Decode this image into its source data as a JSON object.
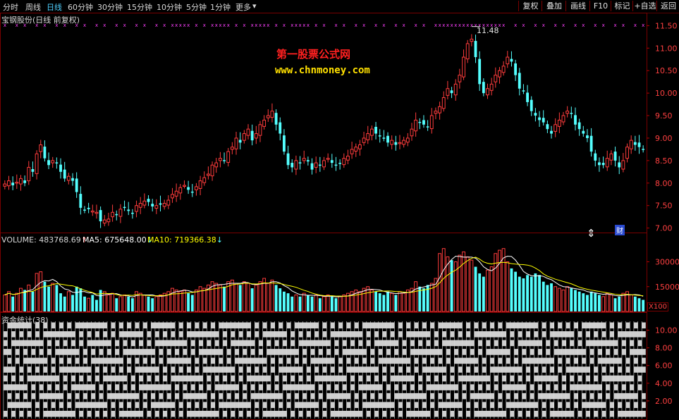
{
  "toolbar": {
    "timeframes": [
      {
        "label": "分时",
        "active": false
      },
      {
        "label": "周线",
        "active": false
      },
      {
        "label": "日线",
        "active": true
      },
      {
        "label": "60分钟",
        "active": false
      },
      {
        "label": "30分钟",
        "active": false
      },
      {
        "label": "15分钟",
        "active": false
      },
      {
        "label": "10分钟",
        "active": false
      },
      {
        "label": "5分钟",
        "active": false
      },
      {
        "label": "1分钟",
        "active": false
      },
      {
        "label": "更多",
        "active": false
      }
    ],
    "more_arrow": "▾",
    "right_buttons": [
      "复权",
      "叠加",
      "画线",
      "F10",
      "标记",
      "+自选",
      "返回"
    ]
  },
  "price_panel": {
    "title": "宝钢股份(日线 前复权)",
    "max_label": "11.48",
    "axis_ticks": [
      "11.50",
      "11.00",
      "10.50",
      "10.00",
      "9.50",
      "9.00",
      "8.50",
      "8.00",
      "7.50",
      "7.00"
    ],
    "watermark_title": "第一股票公式网",
    "watermark_url": "www.chnmoney.com",
    "finance_badge": "财",
    "resize_icon": "⇕"
  },
  "volume_panel": {
    "label_volume": "VOLUME: 483768.69",
    "label_ma5": "MA5: 675648.00",
    "label_ma10": "MA10: 719366.38",
    "volume_arrow": "↑",
    "ma5_arrow": "↓",
    "ma10_arrow": "↓",
    "axis_ticks": [
      "30000",
      "15000"
    ],
    "unit": "X100"
  },
  "fund_panel": {
    "title": "资金统计(38)",
    "axis_ticks": [
      "10.00",
      "8.00",
      "6.00",
      "4.00",
      "2.00"
    ]
  },
  "colors": {
    "up": "#ff3c3c",
    "down": "#54ffff",
    "ma5": "#ffffff",
    "ma10": "#ffff00",
    "grid": "#7a0000",
    "marker": "#ff40ff",
    "watermark_title": "#ff2020",
    "watermark_url": "#ffe000"
  },
  "chart_data": {
    "type": "candlestick",
    "ylim": [
      6.9,
      11.6
    ],
    "close": [
      7.98,
      8.05,
      7.95,
      8.02,
      8.1,
      8.0,
      8.35,
      8.25,
      8.65,
      8.85,
      8.55,
      8.4,
      8.5,
      8.45,
      8.25,
      8.1,
      8.15,
      8.05,
      7.8,
      7.45,
      7.4,
      7.42,
      7.38,
      7.35,
      7.15,
      7.18,
      7.2,
      7.35,
      7.3,
      7.42,
      7.45,
      7.38,
      7.32,
      7.5,
      7.55,
      7.6,
      7.58,
      7.48,
      7.5,
      7.52,
      7.55,
      7.62,
      7.75,
      7.82,
      7.9,
      7.95,
      7.85,
      7.8,
      7.92,
      8.05,
      8.12,
      8.2,
      8.4,
      8.45,
      8.55,
      8.5,
      8.7,
      8.8,
      9.0,
      8.9,
      9.1,
      9.2,
      8.95,
      9.1,
      9.3,
      9.4,
      9.5,
      9.6,
      9.3,
      9.1,
      8.7,
      8.4,
      8.35,
      8.5,
      8.45,
      8.55,
      8.48,
      8.3,
      8.45,
      8.4,
      8.5,
      8.55,
      8.45,
      8.4,
      8.45,
      8.55,
      8.6,
      8.75,
      8.8,
      8.85,
      9.0,
      9.1,
      9.2,
      9.1,
      9.05,
      9.0,
      8.9,
      8.95,
      8.85,
      8.9,
      8.95,
      9.0,
      9.2,
      9.4,
      9.35,
      9.3,
      9.25,
      9.5,
      9.6,
      9.7,
      9.9,
      10.1,
      10.0,
      10.2,
      10.4,
      10.8,
      11.1,
      11.2,
      10.8,
      10.2,
      10.0,
      10.1,
      10.2,
      10.4,
      10.5,
      10.6,
      10.8,
      10.7,
      10.4,
      10.1,
      10.05,
      9.8,
      9.6,
      9.5,
      9.4,
      9.35,
      9.2,
      9.1,
      9.3,
      9.4,
      9.5,
      9.6,
      9.55,
      9.3,
      9.2,
      9.1,
      9.0,
      8.7,
      8.5,
      8.4,
      8.4,
      8.55,
      8.65,
      8.5,
      8.35,
      8.5,
      8.8,
      8.95,
      8.85,
      8.8,
      8.75
    ],
    "volume": [
      10000,
      12000,
      9000,
      11000,
      14000,
      13000,
      16000,
      12000,
      23000,
      24000,
      18000,
      15000,
      17000,
      16000,
      11000,
      9000,
      12000,
      10000,
      15000,
      14000,
      9000,
      8000,
      10000,
      7000,
      13000,
      12000,
      10000,
      11000,
      8000,
      9000,
      10000,
      9000,
      8000,
      12000,
      11000,
      10000,
      9000,
      8000,
      9000,
      10000,
      11000,
      12000,
      14000,
      13000,
      12000,
      13000,
      11000,
      10000,
      13000,
      15000,
      14000,
      16000,
      18000,
      17000,
      16000,
      15000,
      18000,
      19000,
      17000,
      16000,
      18000,
      17000,
      14000,
      16000,
      18000,
      20000,
      17000,
      19000,
      16000,
      14000,
      12000,
      11000,
      9000,
      10000,
      9000,
      11000,
      10000,
      9000,
      10000,
      8000,
      9000,
      10000,
      9000,
      8000,
      9000,
      10000,
      11000,
      12000,
      13000,
      12000,
      14000,
      15000,
      13000,
      12000,
      11000,
      10000,
      12000,
      11000,
      10000,
      12000,
      11000,
      13000,
      14000,
      18000,
      15000,
      14000,
      16000,
      17000,
      20000,
      35000,
      38000,
      33000,
      31000,
      30000,
      34000,
      36000,
      33000,
      31000,
      27000,
      23000,
      21000,
      25000,
      27000,
      35000,
      37000,
      38000,
      30000,
      26000,
      24000,
      21000,
      20000,
      22000,
      21000,
      23000,
      22000,
      18000,
      16000,
      17000,
      15000,
      14000,
      13000,
      15000,
      14000,
      13000,
      12000,
      11000,
      10000,
      12000,
      11000,
      10000,
      9000,
      11000,
      10000,
      8000,
      9000,
      11000,
      12000,
      10000,
      9000,
      8000,
      7000
    ]
  }
}
